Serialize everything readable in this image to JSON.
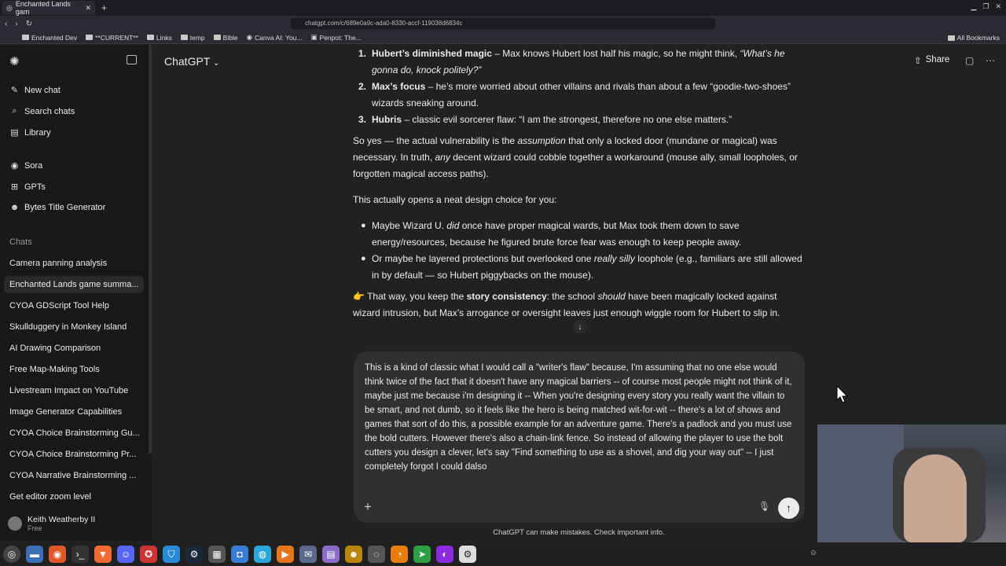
{
  "browser": {
    "tab_title": "Enchanted Lands gam",
    "url": "chatgpt.com/c/689e0a9c-ada0-8330-accf-119038d6834c",
    "bookmarks": [
      "Enchanted Dev",
      "**CURRENT**",
      "Links",
      "temp",
      "Bible",
      "Canva AI: You...",
      "Penpot: The..."
    ],
    "all_bookmarks": "All Bookmarks"
  },
  "sidebar": {
    "nav": [
      {
        "label": "New chat",
        "icon": "edit-icon"
      },
      {
        "label": "Search chats",
        "icon": "search-icon"
      },
      {
        "label": "Library",
        "icon": "library-icon"
      },
      {
        "label": "Sora",
        "icon": "sora-icon"
      },
      {
        "label": "GPTs",
        "icon": "gpts-icon"
      },
      {
        "label": "Bytes Title Generator",
        "icon": "gpt-avatar-icon"
      }
    ],
    "chats_heading": "Chats",
    "chats": [
      "Camera panning analysis",
      "Enchanted Lands game summa...",
      "CYOA GDScript Tool Help",
      "Skullduggery in Monkey Island",
      "AI Drawing Comparison",
      "Free Map-Making Tools",
      "Livestream Impact on YouTube",
      "Image Generator Capabilities",
      "CYOA Choice Brainstorming Gu...",
      "CYOA Choice Brainstorming Pr...",
      "CYOA Narrative Brainstorming ...",
      "Get editor zoom level"
    ],
    "user": {
      "name": "Keith Weatherby II",
      "plan": "Free"
    }
  },
  "header": {
    "model": "ChatGPT",
    "share": "Share"
  },
  "message": {
    "list1": [
      {
        "num": "1.",
        "bold": "Hubert’s diminished magic",
        "rest": " – Max knows Hubert lost half his magic, so he might think, ",
        "italic": "“What’s he gonna do, knock politely?”"
      },
      {
        "num": "2.",
        "bold": "Max’s focus",
        "rest": " – he’s more worried about other villains and rivals than about a few “goodie-two-shoes” wizards sneaking around.",
        "italic": ""
      },
      {
        "num": "3.",
        "bold": "Hubris",
        "rest": " – classic evil sorcerer flaw: “I am the strongest, therefore no one else matters.”",
        "italic": ""
      }
    ],
    "p1_a": "So yes — the actual vulnerability is the ",
    "p1_i": "assumption",
    "p1_b": " that only a locked door (mundane or magical) was necessary. In truth, ",
    "p1_i2": "any",
    "p1_c": " decent wizard could cobble together a workaround (mouse ally, small loopholes, or forgotten magical access paths).",
    "p2": "This actually opens a neat design choice for you:",
    "b1_a": "Maybe Wizard U. ",
    "b1_i": "did",
    "b1_b": " once have proper magical wards, but Max took them down to save energy/resources, because he figured brute force fear was enough to keep people away.",
    "b2_a": "Or maybe he layered protections but overlooked one ",
    "b2_i": "really silly",
    "b2_b": " loophole (e.g., familiars are still allowed in by default — so Hubert piggybacks on the mouse).",
    "p3_emoji": "👉",
    "p3_a": " That way, you keep the ",
    "p3_bold": "story consistency",
    "p3_b": ": the school ",
    "p3_i": "should",
    "p3_c": " have been magically locked against wizard intrusion, but Max’s arrogance or oversight leaves just enough wiggle room for Hubert to slip in."
  },
  "composer": {
    "text": "This is a kind of classic what I would call a \"writer's flaw\" because, I'm assuming that no one else would think twice of the fact that it doesn't have any magical barriers -- of course most people might not think of it, maybe just me because i'm designing it -- When you're designing every story you really want the villain to be smart, and not dumb, so it feels like the hero is being matched wit-for-wit -- there's a lot of shows and games that sort of do this, a possible example for an adventure game.  There's a padlock and you must use the bold cutters.  However there's also a chain-link fence.  So instead of allowing the player to use the bolt cutters you design a clever, let's say \"Find something to use as a shovel, and dig your way out\" -- I just completely forgot I could dalso"
  },
  "disclaimer": "ChatGPT can make mistakes. Check important info."
}
